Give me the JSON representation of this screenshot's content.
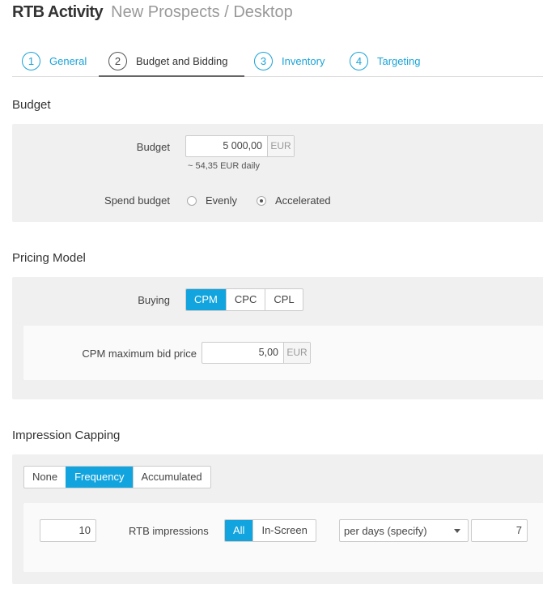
{
  "header": {
    "title": "RTB Activity",
    "subtitle": "New Prospects / Desktop"
  },
  "tabs": [
    {
      "num": "1",
      "label": "General",
      "active": false
    },
    {
      "num": "2",
      "label": "Budget and Bidding",
      "active": true
    },
    {
      "num": "3",
      "label": "Inventory",
      "active": false
    },
    {
      "num": "4",
      "label": "Targeting",
      "active": false
    }
  ],
  "budget": {
    "section_title": "Budget",
    "budget_label": "Budget",
    "budget_value": "5 000,00",
    "budget_unit": "EUR",
    "daily_hint": "~ 54,35 EUR daily",
    "spend_label": "Spend budget",
    "spend_options": [
      {
        "label": "Evenly",
        "checked": false
      },
      {
        "label": "Accelerated",
        "checked": true
      }
    ]
  },
  "pricing": {
    "section_title": "Pricing Model",
    "buying_label": "Buying",
    "buying_options": [
      {
        "label": "CPM",
        "active": true
      },
      {
        "label": "CPC",
        "active": false
      },
      {
        "label": "CPL",
        "active": false
      }
    ],
    "max_bid_label": "CPM maximum bid price",
    "max_bid_value": "5,00",
    "max_bid_unit": "EUR"
  },
  "capping": {
    "section_title": "Impression Capping",
    "mode_options": [
      {
        "label": "None",
        "active": false
      },
      {
        "label": "Frequency",
        "active": true
      },
      {
        "label": "Accumulated",
        "active": false
      }
    ],
    "count_value": "10",
    "impressions_label": "RTB impressions",
    "scope_options": [
      {
        "label": "All",
        "active": true
      },
      {
        "label": "In-Screen",
        "active": false
      }
    ],
    "period_select": "per days (specify)",
    "days_value": "7"
  },
  "colors": {
    "accent": "#11a4de",
    "panel": "#f0f0f0",
    "inner_panel": "#fafafa"
  }
}
